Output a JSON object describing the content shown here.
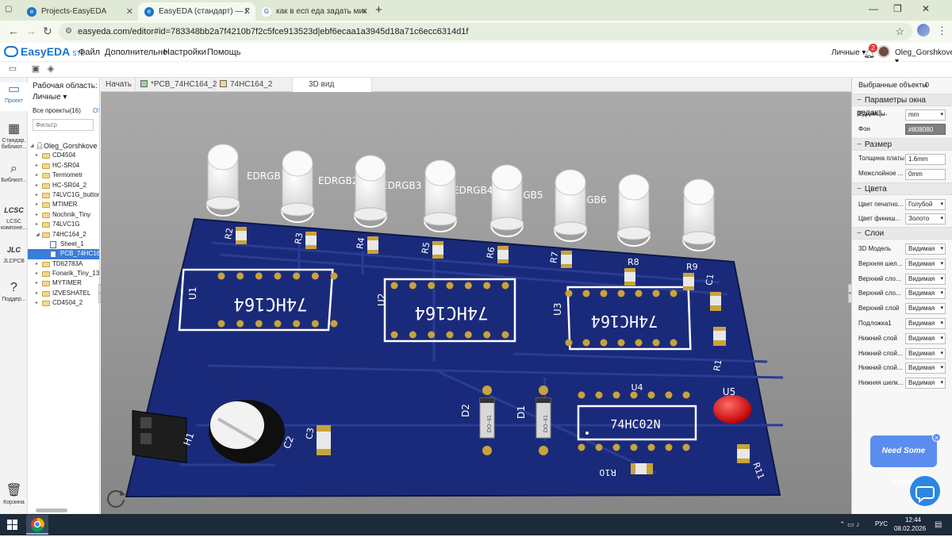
{
  "browser": {
    "tabs": [
      {
        "label": "Projects-EasyEDA",
        "active": false
      },
      {
        "label": "EasyEDA (стандарт) — Просто",
        "active": true
      },
      {
        "label": "как в есп еда задать минимал",
        "active": false
      }
    ],
    "url": "easyeda.com/editor#id=783348bb2a7f4210b7f2c5fce913523d|ebf6ecaa1a3945d18a71c6ecc6314d1f"
  },
  "app": {
    "logo_text": "EasyEDA",
    "logo_sub": "STD",
    "menu": [
      "Файл",
      "Дополнительно",
      "Настройки",
      "Помощь"
    ],
    "workspace_select": "Личные",
    "notification_count": "2",
    "user_name": "Oleg_Gorshkove"
  },
  "leftrail": [
    {
      "label": "Проект",
      "icon": "folder-icon"
    },
    {
      "label": "Стандар. библиот...",
      "icon": "chip-icon"
    },
    {
      "label": "Библиот...",
      "icon": "search-icon"
    },
    {
      "label": "LCSC компоне...",
      "icon": "lcsc-icon"
    },
    {
      "label": "JLCPCB",
      "icon": "jlcpcb-icon"
    },
    {
      "label": "Поддер...",
      "icon": "help-icon"
    },
    {
      "label": "Корзина",
      "icon": "trash-icon"
    }
  ],
  "tree": {
    "workspace_label": "Рабочая область:",
    "workspace_value": "Личные",
    "all_projects": "Все проекты(16)",
    "all_projects_more": "От",
    "filter_placeholder": "Фильтр",
    "root": "Oleg_Gorshkove",
    "items": [
      {
        "label": "CD4504",
        "type": "folder",
        "level": 1
      },
      {
        "label": "HC-SR04",
        "type": "folder",
        "level": 1
      },
      {
        "label": "Termometr",
        "type": "folder",
        "level": 1
      },
      {
        "label": "HC-SR04_2",
        "type": "folder",
        "level": 1
      },
      {
        "label": "74LVC1G_button",
        "type": "folder",
        "level": 1
      },
      {
        "label": "MTIMER",
        "type": "folder",
        "level": 1
      },
      {
        "label": "Nochnik_Tiny",
        "type": "folder",
        "level": 1
      },
      {
        "label": "74LVC1G",
        "type": "folder",
        "level": 1
      },
      {
        "label": "74HC164_2",
        "type": "folder-open",
        "level": 1
      },
      {
        "label": "Sheet_1",
        "type": "doc",
        "level": 2
      },
      {
        "label": "PCB_74HC164_",
        "type": "doc",
        "level": 2,
        "selected": true
      },
      {
        "label": "TD62783A",
        "type": "folder",
        "level": 1
      },
      {
        "label": "Fonarik_Tiny_13",
        "type": "folder",
        "level": 1
      },
      {
        "label": "MYTIMER",
        "type": "folder",
        "level": 1
      },
      {
        "label": "IZVESHATEL",
        "type": "folder",
        "level": 1
      },
      {
        "label": "CD4504_2",
        "type": "folder",
        "level": 1
      }
    ]
  },
  "doctabs": [
    {
      "label": "Начать",
      "icon": "",
      "active": false
    },
    {
      "label": "*PCB_74HC164_2",
      "icon": "pcb-icon",
      "active": false
    },
    {
      "label": "74HC164_2",
      "icon": "schematic-icon",
      "active": false
    },
    {
      "label": "3D вид",
      "icon": "",
      "active": true
    }
  ],
  "board": {
    "colors": {
      "pcb": "#1a2a7a",
      "silk": "#ffffff",
      "pad": "#c9a33a"
    },
    "rgb_labels": [
      "EDRGB1",
      "EDRGB2",
      "EDRGB3",
      "EDRGB4",
      "RGB5",
      "RGB6"
    ],
    "res_labels": [
      "R2",
      "R3",
      "R4",
      "R5",
      "R6",
      "R7",
      "R8",
      "R9"
    ],
    "ic_refs": [
      "U1",
      "U2",
      "U3"
    ],
    "ic_part": "74HC164",
    "u4_ref": "U4",
    "u4_part": "74HC02N",
    "u5_ref": "U5",
    "diode_refs": [
      "D2",
      "D1"
    ],
    "diode_pkg": "DO-41",
    "other_labels": [
      "C1",
      "R1",
      "H1",
      "C2",
      "C3",
      "R10",
      "R11"
    ]
  },
  "rightpanel": {
    "selected_objects": "Выбранные объекты",
    "selected_count": "0",
    "sections": {
      "view_params": "Параметры окна редакт...",
      "size": "Размер",
      "colors": "Цвета",
      "layers": "Слои"
    },
    "units_label": "Единицы",
    "units_value": "mm",
    "bg_label": "Фон",
    "bg_value": "#808080",
    "thickness_label": "Толщина платы",
    "thickness_value": "1.6mm",
    "interlayer_label": "Межслойное ...",
    "interlayer_value": "0mm",
    "silk_color_label": "Цвет печатно...",
    "silk_color_value": "Голубой",
    "finish_color_label": "Цвет финиш...",
    "finish_color_value": "Золото",
    "layers": [
      {
        "label": "3D Модель",
        "value": "Видимая"
      },
      {
        "label": "Верхняя шел...",
        "value": "Видимая"
      },
      {
        "label": "Верхний сло...",
        "value": "Видимая"
      },
      {
        "label": "Верхний сло...",
        "value": "Видимая"
      },
      {
        "label": "Верхний слой",
        "value": "Видимая"
      },
      {
        "label": "Подложка1",
        "value": "Видимая"
      },
      {
        "label": "Нижний слой",
        "value": "Видимая"
      },
      {
        "label": "Нижний слой...",
        "value": "Видимая"
      },
      {
        "label": "Нижний слой...",
        "value": "Видимая"
      },
      {
        "label": "Нижняя шелк...",
        "value": "Видимая"
      }
    ],
    "help_text": "Need Some Help?",
    "help_close": "×"
  },
  "taskbar": {
    "lang": "РУС",
    "time": "12:44",
    "date": "08.02.2026"
  }
}
